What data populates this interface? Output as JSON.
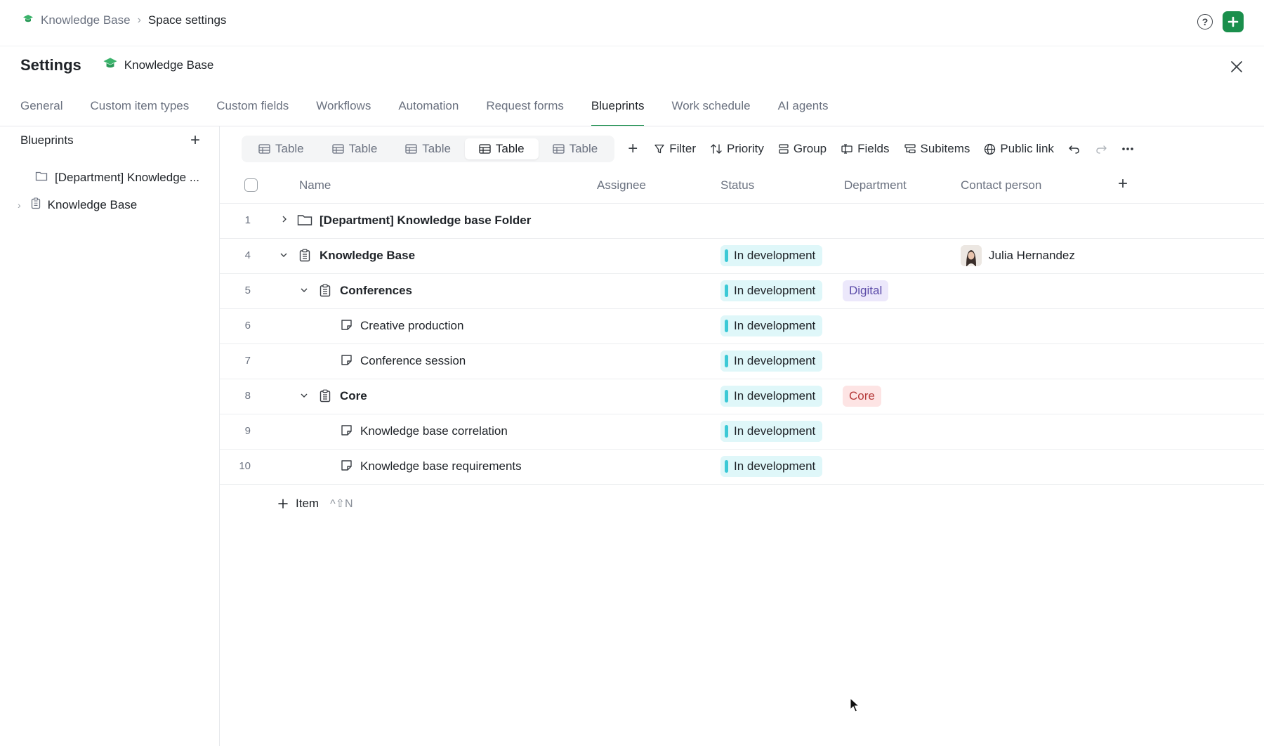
{
  "breadcrumb": {
    "items": [
      "Knowledge Base",
      "Space settings"
    ]
  },
  "header": {
    "title": "Settings",
    "space_name": "Knowledge Base"
  },
  "tabs": [
    {
      "label": "General"
    },
    {
      "label": "Custom item types"
    },
    {
      "label": "Custom fields"
    },
    {
      "label": "Workflows"
    },
    {
      "label": "Automation"
    },
    {
      "label": "Request forms"
    },
    {
      "label": "Blueprints",
      "active": true
    },
    {
      "label": "Work schedule"
    },
    {
      "label": "AI agents"
    }
  ],
  "sidebar": {
    "title": "Blueprints",
    "items": [
      {
        "label": "[Department] Knowledge ...",
        "icon": "folder-icon"
      },
      {
        "label": "Knowledge Base",
        "icon": "clipboard-icon"
      }
    ]
  },
  "toolbar": {
    "views": [
      "Table",
      "Table",
      "Table",
      "Table",
      "Table"
    ],
    "active_view_index": 3,
    "filter": "Filter",
    "priority": "Priority",
    "group": "Group",
    "fields": "Fields",
    "subitems": "Subitems",
    "public_link": "Public link"
  },
  "table": {
    "columns": {
      "name": "Name",
      "assignee": "Assignee",
      "status": "Status",
      "department": "Department",
      "contact": "Contact person"
    },
    "rows": [
      {
        "num": "1",
        "name": "[Department] Knowledge base Folder",
        "bold": true
      },
      {
        "num": "4",
        "name": "Knowledge Base",
        "bold": true,
        "status": "In development",
        "contact": "Julia Hernandez"
      },
      {
        "num": "5",
        "name": "Conferences",
        "bold": true,
        "status": "In development",
        "department": "Digital"
      },
      {
        "num": "6",
        "name": "Creative production",
        "status": "In development"
      },
      {
        "num": "7",
        "name": "Conference session",
        "status": "In development"
      },
      {
        "num": "8",
        "name": "Core",
        "bold": true,
        "status": "In development",
        "department": "Core"
      },
      {
        "num": "9",
        "name": "Knowledge base correlation",
        "status": "In development"
      },
      {
        "num": "10",
        "name": "Knowledge base requirements",
        "status": "In development"
      }
    ],
    "add_item": {
      "label": "Item",
      "shortcut": "^⇧N"
    }
  },
  "colors": {
    "brand": "#1a8f4c",
    "status_bg": "#dff7f9",
    "status_bar": "#3cc9d6",
    "tag_digital_bg": "#ece8fb",
    "tag_digital_text": "#5b4ba8",
    "tag_core_bg": "#fde4e4",
    "tag_core_text": "#b53a3a"
  }
}
